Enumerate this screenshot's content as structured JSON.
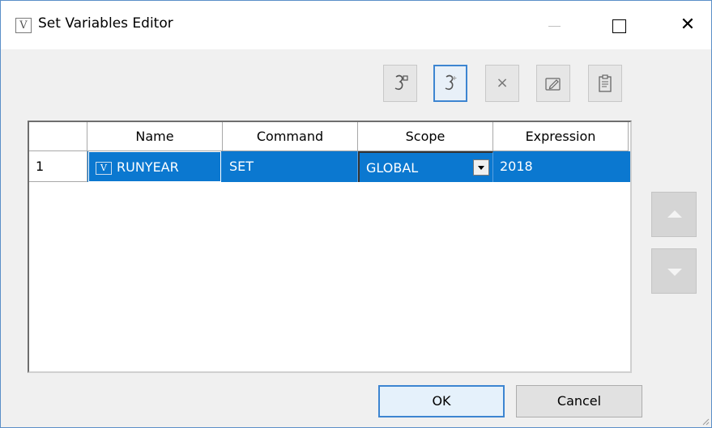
{
  "window": {
    "title": "Set Variables Editor",
    "icon_letter": "V",
    "caption_buttons": [
      "minimize-icon",
      "maximize-icon",
      "close-icon"
    ],
    "close_glyph": "✕"
  },
  "toolbar": {
    "buttons": [
      {
        "name": "add-variable",
        "icon": "add-variable-icon"
      },
      {
        "name": "insert-variable",
        "icon": "insert-variable-icon",
        "active": true
      },
      {
        "name": "delete",
        "icon": "delete-icon",
        "glyph": "×"
      },
      {
        "name": "edit",
        "icon": "edit-icon"
      },
      {
        "name": "paste",
        "icon": "clipboard-icon"
      }
    ]
  },
  "grid": {
    "columns": [
      "",
      "Name",
      "Command",
      "Scope",
      "Expression"
    ],
    "rows": [
      {
        "num": "1",
        "name": "RUNYEAR",
        "command": "SET",
        "scope": "GLOBAL",
        "expression": "2018",
        "selected": true
      }
    ]
  },
  "move_buttons": [
    "move-up",
    "move-down"
  ],
  "dialog": {
    "ok_label": "OK",
    "cancel_label": "Cancel"
  },
  "colors": {
    "selection": "#0b78d0",
    "accent": "#3d85d1",
    "window_border": "#5b8fc8"
  }
}
